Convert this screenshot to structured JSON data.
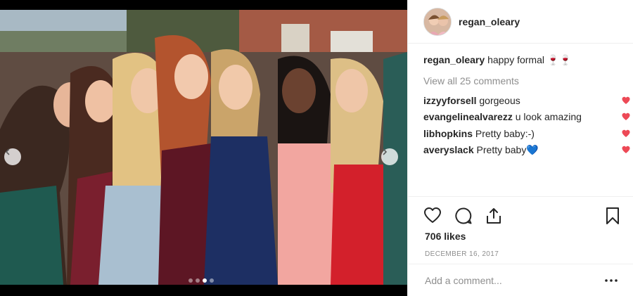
{
  "post": {
    "username": "regan_oleary",
    "likes": "706 likes",
    "date": "DECEMBER 16, 2017",
    "add_comment_placeholder": "Add a comment...",
    "carousel": {
      "total_slides": 4,
      "active_slide": 3
    }
  },
  "caption": {
    "username": "regan_oleary",
    "text": "happy formal",
    "emoji": "🍷🍷"
  },
  "view_all_comments": "View all 25 comments",
  "comments": [
    {
      "username": "izzyyforsell",
      "text": "gorgeous"
    },
    {
      "username": "evangelinealvarezz",
      "text": "u look amazing"
    },
    {
      "username": "libhopkins",
      "text": "Pretty baby:-)"
    },
    {
      "username": "averyslack",
      "text": "Pretty baby💙"
    }
  ],
  "colors": {
    "heart_red": "#ed4956",
    "text_primary": "#262626",
    "text_secondary": "#8e8e8e",
    "divider": "#efefef"
  },
  "icons": {
    "like": "heart-outline-icon",
    "comment": "speech-bubble-icon",
    "share": "share-arrow-icon",
    "save": "bookmark-icon",
    "more": "ellipsis-icon",
    "carousel_prev": "chevron-left-icon",
    "carousel_next": "chevron-right-icon"
  }
}
